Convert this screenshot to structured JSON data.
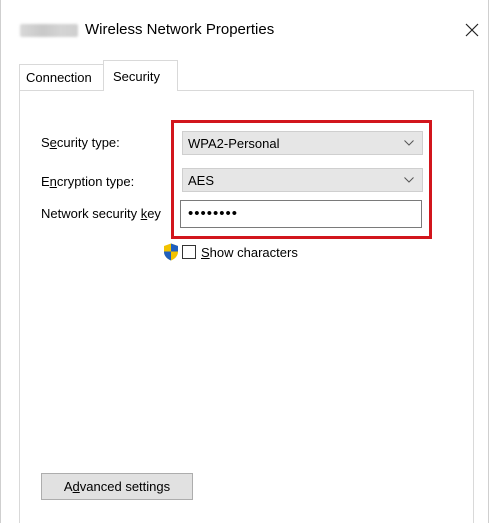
{
  "window": {
    "title": "Wireless Network Properties",
    "title_prefix_blurred": "CRESTEC"
  },
  "tabs": [
    {
      "label": "Connection",
      "selected": false
    },
    {
      "label": "Security",
      "selected": true
    }
  ],
  "security": {
    "security_type": {
      "label_pre": "S",
      "label_acc": "e",
      "label_post": "curity type:",
      "value": "WPA2-Personal"
    },
    "encryption_type": {
      "label_pre": "E",
      "label_acc": "n",
      "label_post": "cryption type:",
      "value": "AES"
    },
    "network_key": {
      "label_pre": "Network security ",
      "label_acc": "k",
      "label_post": "ey",
      "value": "••••••••"
    },
    "show_characters": {
      "label_acc": "S",
      "label_post": "how characters",
      "checked": false
    }
  },
  "advanced_button": {
    "label_pre": "A",
    "label_acc": "d",
    "label_post": "vanced settings"
  },
  "colors": {
    "highlight": "#d2151c",
    "select_bg": "#e6e6e6",
    "button_bg": "#e1e1e1"
  },
  "icons": {
    "close": "close-icon",
    "dropdown": "chevron-down-icon",
    "uac": "shield-icon"
  }
}
